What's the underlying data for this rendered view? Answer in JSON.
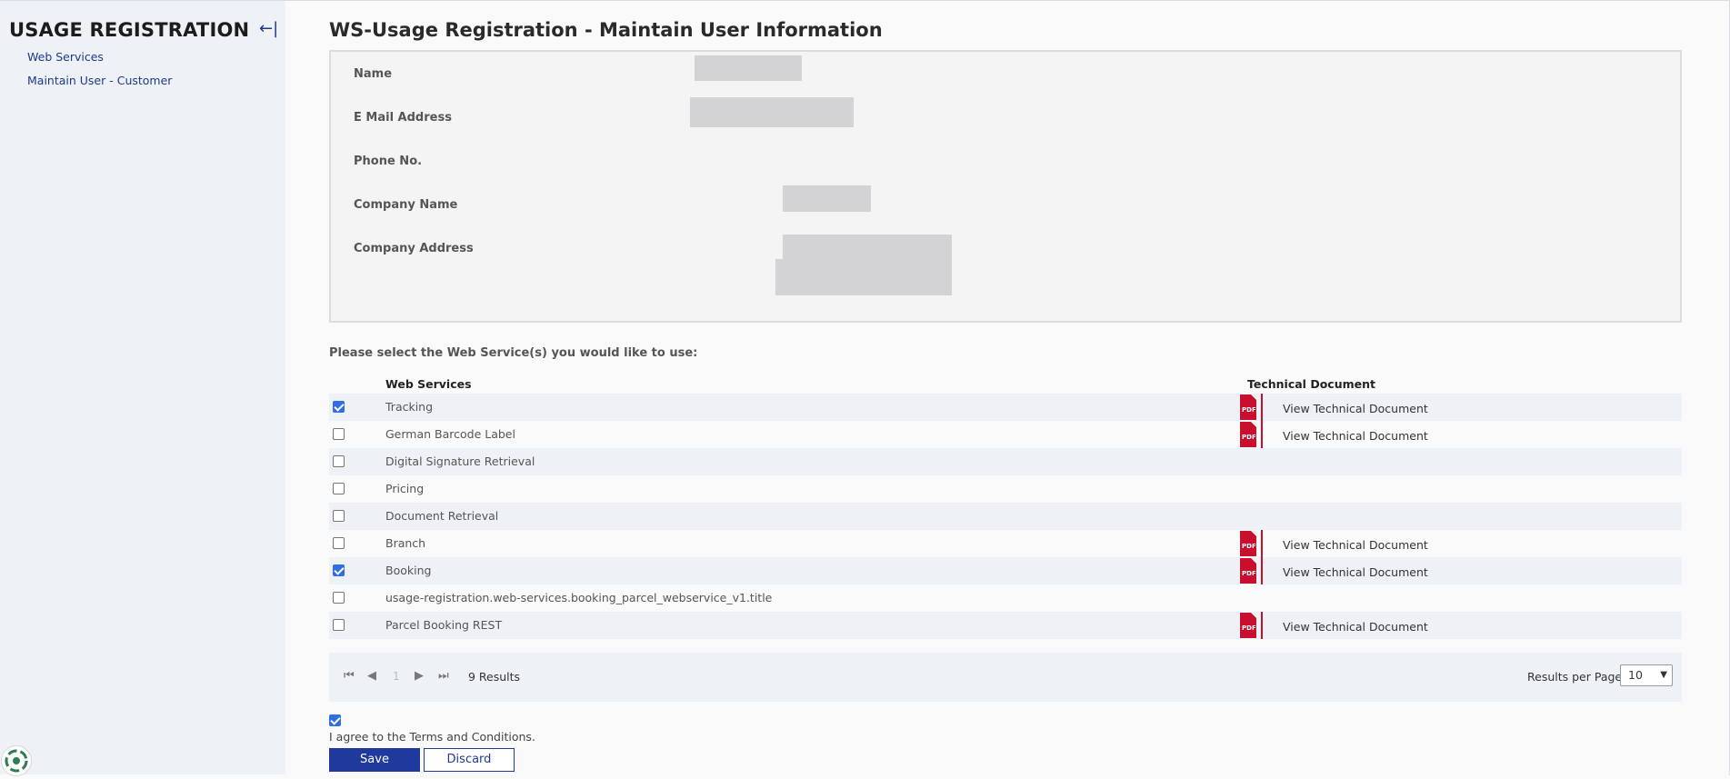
{
  "sidebar": {
    "title": "USAGE REGISTRATION",
    "collapse_icon": "←|",
    "items": [
      {
        "label": "Web Services"
      },
      {
        "label": "Maintain User - Customer"
      }
    ]
  },
  "page": {
    "title": "WS-Usage Registration - Maintain User Information"
  },
  "user_info": {
    "name_label": "Name",
    "email_label": "E Mail Address",
    "phone_label": "Phone No.",
    "company_label": "Company Name",
    "address_label": "Company Address"
  },
  "services": {
    "prompt": "Please select the Web Service(s) you would like to use:",
    "col_services": "Web Services",
    "col_doc": "Technical Document",
    "rows": [
      {
        "name": "Tracking",
        "checked": true,
        "doc": "View Technical Document"
      },
      {
        "name": "German Barcode Label",
        "checked": false,
        "doc": "View Technical Document"
      },
      {
        "name": "Digital Signature Retrieval",
        "checked": false,
        "doc": ""
      },
      {
        "name": "Pricing",
        "checked": false,
        "doc": ""
      },
      {
        "name": "Document Retrieval",
        "checked": false,
        "doc": ""
      },
      {
        "name": "Branch",
        "checked": false,
        "doc": "View Technical Document"
      },
      {
        "name": "Booking",
        "checked": true,
        "doc": "View Technical Document"
      },
      {
        "name": "usage-registration.web-services.booking_parcel_webservice_v1.title",
        "checked": false,
        "doc": ""
      },
      {
        "name": "Parcel Booking REST",
        "checked": false,
        "doc": "View Technical Document"
      }
    ]
  },
  "pager": {
    "page": "1",
    "results": "9 Results",
    "rpp_label": "Results per Page",
    "rpp_value": "10"
  },
  "terms": {
    "checked": true,
    "text": "I agree to the Terms and Conditions."
  },
  "actions": {
    "save": "Save",
    "discard": "Discard"
  },
  "colors": {
    "accent": "#1f3a9c",
    "pdf_red": "#c8102e"
  }
}
